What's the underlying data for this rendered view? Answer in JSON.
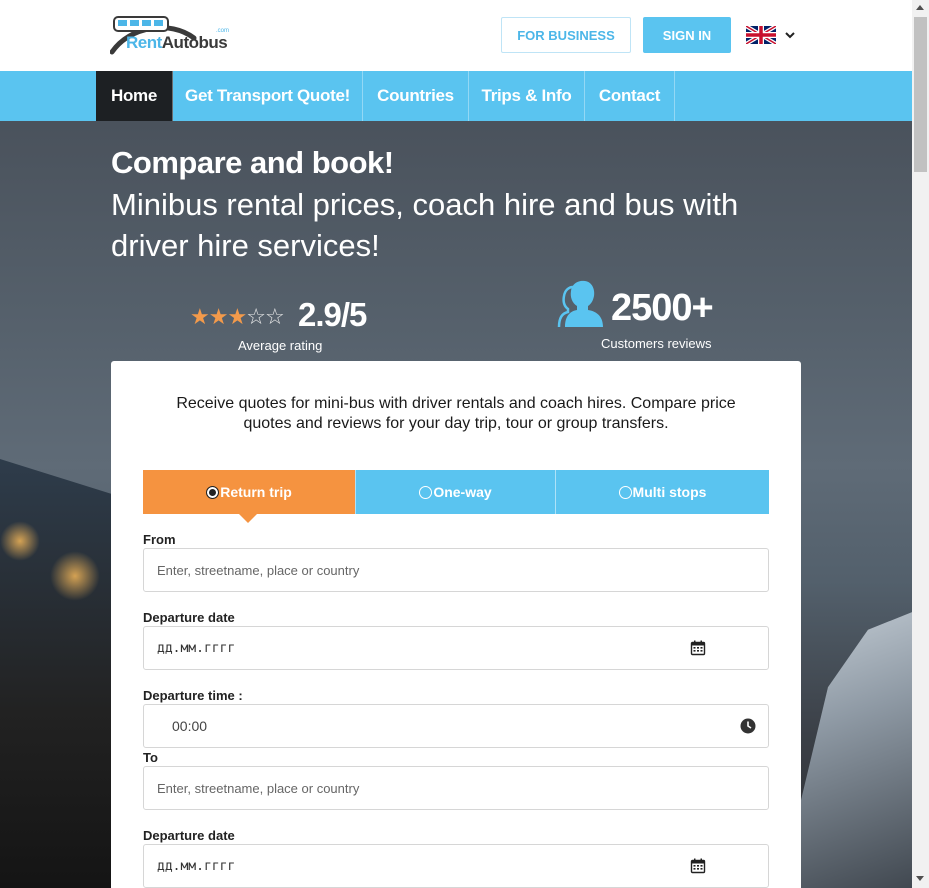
{
  "brand": {
    "logo_part1": "Rent",
    "logo_part2": "Autobus",
    "logo_suffix": ".com",
    "accent": "#5ac4f0",
    "orange": "#f59340"
  },
  "header": {
    "for_business": "FOR BUSINESS",
    "sign_in": "SIGN IN",
    "language_icon": "uk-flag-icon"
  },
  "nav": {
    "items": [
      {
        "label": "Home"
      },
      {
        "label": "Get Transport Quote!"
      },
      {
        "label": "Countries"
      },
      {
        "label": "Trips & Info"
      },
      {
        "label": "Contact"
      }
    ]
  },
  "hero": {
    "title": "Compare and book!",
    "subtitle": "Minibus rental prices, coach hire and bus with driver hire services!",
    "rating_value": "2.9/5",
    "rating_stars": 2.9,
    "rating_label": "Average rating",
    "reviews_value": "2500+",
    "reviews_label": "Customers reviews"
  },
  "form": {
    "intro": "Receive quotes for mini-bus with driver rentals and coach hires. Compare price quotes and reviews for your day trip, tour or group transfers.",
    "tabs": [
      {
        "label": "Return trip"
      },
      {
        "label": "One-way"
      },
      {
        "label": "Multi stops"
      }
    ],
    "from_label": "From",
    "from_placeholder": "Enter, streetname, place or country",
    "departure_date_label": "Departure date",
    "departure_date_value": "дд.мм.гггг",
    "departure_time_label": "Departure time :",
    "departure_time_value": "00:00",
    "to_label": "To",
    "to_placeholder": "Enter, streetname, place or country",
    "departure_date2_label": "Departure date",
    "departure_date2_value": "дд.мм.гггг"
  }
}
